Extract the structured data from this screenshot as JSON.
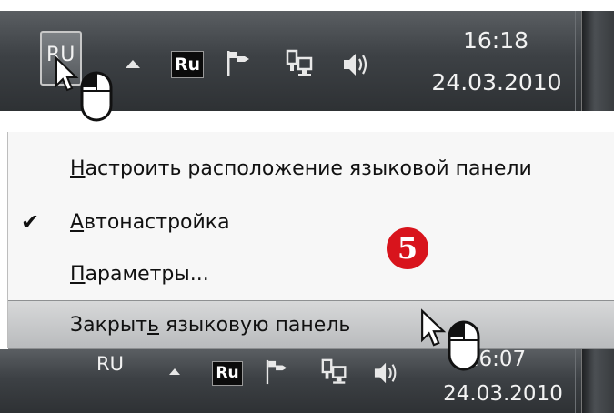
{
  "top_taskbar": {
    "language_indicator": "RU",
    "ru_badge": "Ru",
    "clock_time": "16:18",
    "clock_date": "24.03.2010",
    "icons": [
      "show-hidden-icons-arrow",
      "flag-icon",
      "network-icon",
      "volume-icon"
    ]
  },
  "menu": {
    "items": [
      {
        "text_before": "",
        "accel": "Н",
        "text_after": "астроить расположение языковой панели",
        "checked": false
      },
      {
        "text_before": "",
        "accel": "А",
        "text_after": "втонастройка",
        "checked": true
      },
      {
        "text_before": "",
        "accel": "П",
        "text_after": "араметры...",
        "checked": false
      },
      {
        "text_before": "Закрыт",
        "accel": "ь",
        "text_after": " языковую панель",
        "checked": false
      }
    ],
    "check_glyph": "✔"
  },
  "step_badge": "5",
  "bottom_taskbar": {
    "language_indicator": "RU",
    "ru_badge": "Ru",
    "clock_time": "16:07",
    "clock_date": "24.03.2010"
  },
  "colors": {
    "taskbar": "#3d4145",
    "menu_background": "#f7f7f7",
    "menu_highlight": "#c8cacc",
    "step_badge": "#d8141c"
  }
}
